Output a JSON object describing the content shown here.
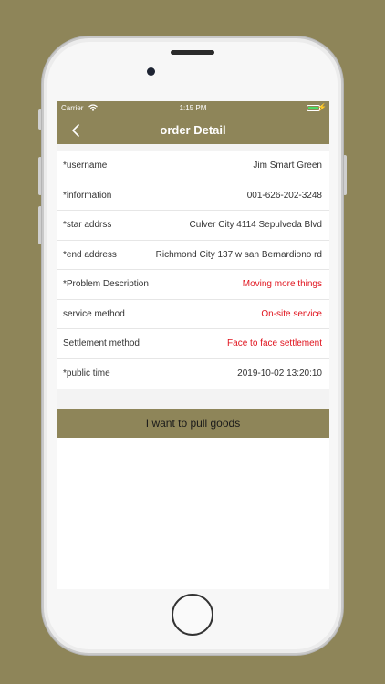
{
  "status_bar": {
    "carrier": "Carrier",
    "time": "1:15 PM",
    "wifi_icon": "wifi-icon",
    "battery_icon": "battery-icon",
    "charging_icon": "bolt-icon"
  },
  "nav": {
    "title": "order Detail",
    "back_icon": "chevron-left-icon"
  },
  "details": [
    {
      "label": "*username",
      "value": "Jim Smart Green",
      "highlight": false
    },
    {
      "label": "*information",
      "value": "001-626-202-3248",
      "highlight": false
    },
    {
      "label": "*star addrss",
      "value": "Culver City 4114 Sepulveda Blvd",
      "highlight": false
    },
    {
      "label": "*end address",
      "value": "Richmond City 137 w san Bernardiono rd",
      "highlight": false
    },
    {
      "label": "*Problem Description",
      "value": "Moving more things",
      "highlight": true
    },
    {
      "label": "service method",
      "value": "On-site service",
      "highlight": true
    },
    {
      "label": "Settlement method",
      "value": "Face to face settlement",
      "highlight": true
    },
    {
      "label": "*public time",
      "value": "2019-10-02 13:20:10",
      "highlight": false
    }
  ],
  "action": {
    "label": "I want to pull goods"
  },
  "colors": {
    "accent": "#8E8559",
    "highlight_text": "#e0141e",
    "battery": "#4cd964"
  }
}
